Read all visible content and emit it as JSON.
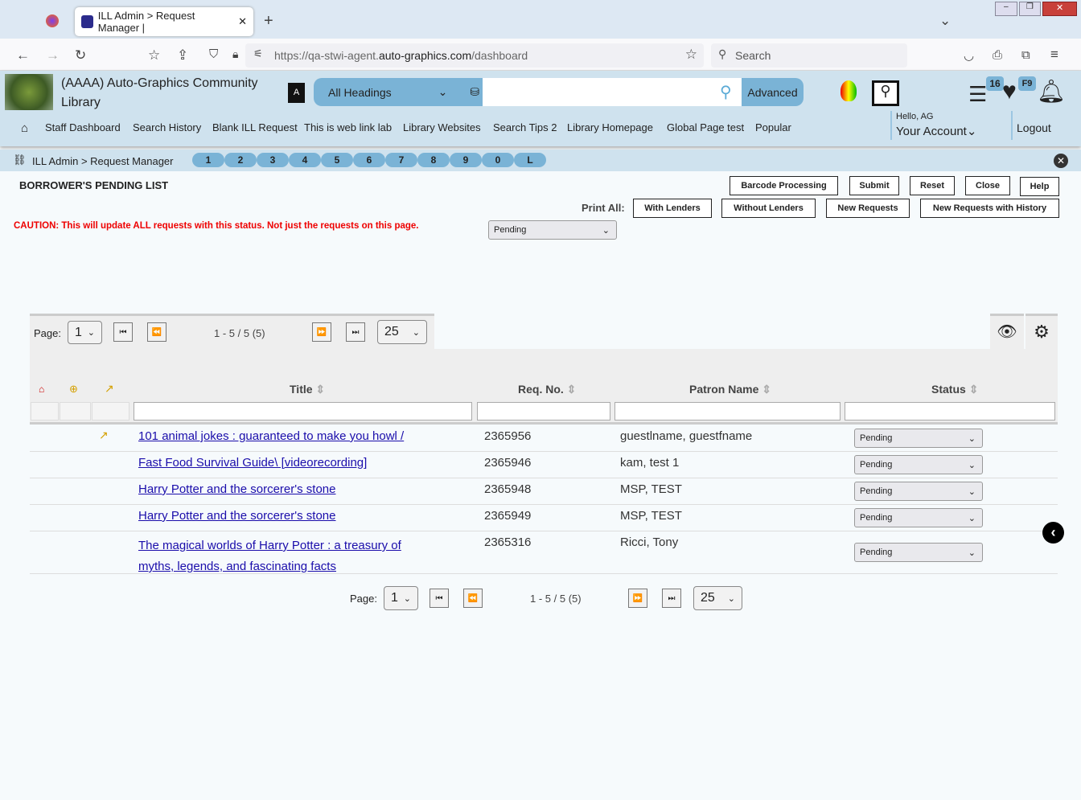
{
  "browser": {
    "tab_title": "ILL Admin > Request Manager |",
    "url_prefix": "https://qa-stwi-agent.",
    "url_domain": "auto-graphics.com",
    "url_path": "/dashboard",
    "search_placeholder": "Search"
  },
  "header": {
    "library_name_1": "(AAAA) Auto-Graphics Community",
    "library_name_2": "Library",
    "heading_select": "All Headings",
    "advanced": "Advanced",
    "badge_list": "16",
    "badge_heart": "F9",
    "hello": "Hello, AG",
    "account": "Your Account",
    "logout": "Logout"
  },
  "nav": [
    "Staff Dashboard",
    "Search History",
    "Blank ILL Request",
    "This is web link lab",
    "Library Websites",
    "Search Tips 2",
    "Library Homepage",
    "Global Page test",
    "Popular"
  ],
  "breadcrumb": "ILL Admin > Request Manager",
  "pills": [
    "1",
    "2",
    "3",
    "4",
    "5",
    "6",
    "7",
    "8",
    "9",
    "0",
    "L"
  ],
  "page": {
    "title": "BORROWER'S PENDING LIST",
    "caution": "CAUTION: This will update ALL requests with this status. Not just the requests on this page.",
    "status_select": "Pending",
    "print_all": "Print All:",
    "buttons": [
      "Barcode Processing",
      "Submit",
      "Reset",
      "Close",
      "Help"
    ],
    "print_buttons": [
      "With Lenders",
      "Without Lenders",
      "New Requests",
      "New Requests with History"
    ]
  },
  "pager": {
    "label": "Page:",
    "page": "1",
    "range": "1 - 5 / 5 (5)",
    "per_page": "25"
  },
  "table": {
    "headers": [
      "Title",
      "Req. No.",
      "Patron Name",
      "Status"
    ],
    "rows": [
      {
        "title": "101 animal jokes : guaranteed to make you howl /",
        "req": "2365956",
        "patron": "guestlname, guestfname",
        "status": "Pending",
        "flag": true
      },
      {
        "title": "Fast Food Survival Guide\\ [videorecording]",
        "req": "2365946",
        "patron": "kam, test 1",
        "status": "Pending"
      },
      {
        "title": "Harry Potter and the sorcerer's stone",
        "req": "2365948",
        "patron": "MSP, TEST",
        "status": "Pending"
      },
      {
        "title": "Harry Potter and the sorcerer's stone",
        "req": "2365949",
        "patron": "MSP, TEST",
        "status": "Pending"
      },
      {
        "title_1": "The magical worlds of Harry Potter : a treasury of",
        "title_2": "myths, legends, and fascinating facts",
        "req": "2365316",
        "patron": "Ricci, Tony",
        "status": "Pending"
      }
    ]
  }
}
